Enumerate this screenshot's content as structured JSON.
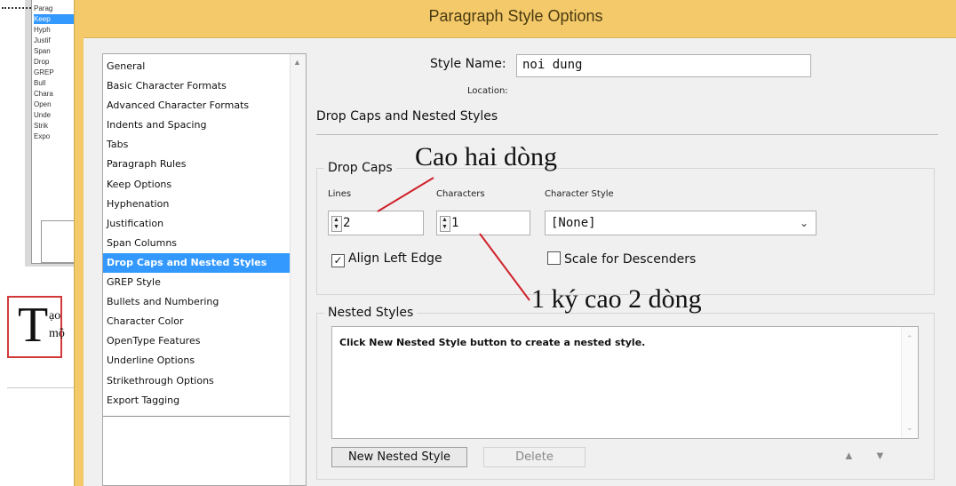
{
  "background": {
    "panel_items": [
      "Parag",
      "Keep",
      "Hyph",
      "Justif",
      "Span",
      "Drop",
      "GREP",
      "Bull",
      "Chara",
      "Open",
      "Unde",
      "Strik",
      "Expo"
    ],
    "sample_dropcap": "T",
    "sample_line1": "ạo",
    "sample_line2": "mộ"
  },
  "dialog": {
    "title": "Paragraph Style Options",
    "style_name_label": "Style Name:",
    "style_name_value": "noi dung",
    "location_label": "Location:",
    "section_heading": "Drop Caps and Nested Styles",
    "categories": [
      "General",
      "Basic Character Formats",
      "Advanced Character Formats",
      "Indents and Spacing",
      "Tabs",
      "Paragraph Rules",
      "Keep Options",
      "Hyphenation",
      "Justification",
      "Span Columns",
      "Drop Caps and Nested Styles",
      "GREP Style",
      "Bullets and Numbering",
      "Character Color",
      "OpenType Features",
      "Underline Options",
      "Strikethrough Options",
      "Export Tagging"
    ],
    "selected_category": "Drop Caps and Nested Styles",
    "drop_caps": {
      "group_title": "Drop Caps",
      "lines_label": "Lines",
      "lines_value": "2",
      "characters_label": "Characters",
      "characters_value": "1",
      "character_style_label": "Character Style",
      "character_style_value": "[None]",
      "align_left_edge_label": "Align Left Edge",
      "align_left_edge_checked": true,
      "scale_descenders_label": "Scale for Descenders",
      "scale_descenders_checked": false
    },
    "nested_styles": {
      "group_title": "Nested Styles",
      "empty_message": "Click New Nested Style button to create a nested style.",
      "new_button": "New Nested Style",
      "delete_button": "Delete"
    }
  },
  "annotations": {
    "lines_note": "Cao hai dòng",
    "characters_note": "1 ký cao 2 dòng",
    "line_color": "#d0212a"
  }
}
